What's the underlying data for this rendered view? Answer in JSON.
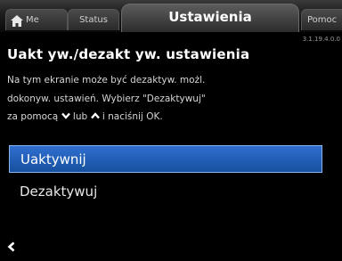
{
  "tabs": {
    "home_label": "Me",
    "status_label": "Status",
    "active_label": "Ustawienia",
    "help_label": "Pomoc"
  },
  "version": "3.1.19.4.0.0",
  "title": "Uakt yw./dezakt yw. ustawienia",
  "description": {
    "line1": "Na tym ekranie może być dezaktyw. możl.",
    "line2": "dokonyw. ustawień. Wybierz \"Dezaktywuj\"",
    "line3_pre": "za pomocą",
    "line3_mid": "lub",
    "line3_post": "i naciśnij OK."
  },
  "options": [
    {
      "label": "Uaktywnij",
      "selected": true
    },
    {
      "label": "Dezaktywuj",
      "selected": false
    }
  ],
  "icons": {
    "home": "house-icon",
    "down": "chevron-down-icon",
    "up": "chevron-up-icon",
    "back": "chevron-left-icon"
  },
  "colors": {
    "selection": "#1f5fbf",
    "selection_border": "#8ab4f0"
  }
}
